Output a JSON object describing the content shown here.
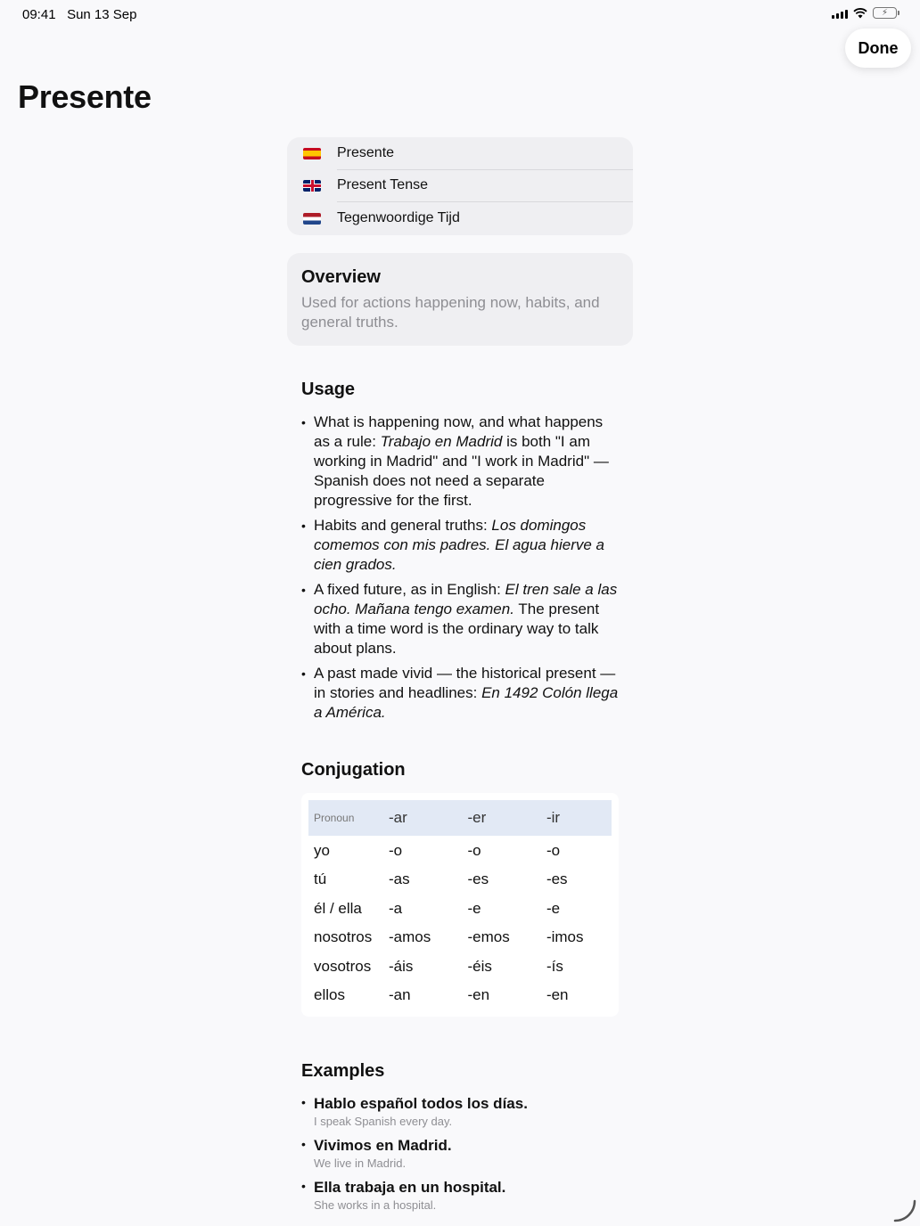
{
  "status_bar": {
    "time": "09:41",
    "date": "Sun 13 Sep"
  },
  "toolbar": {
    "done_label": "Done"
  },
  "title": "Presente",
  "names": [
    {
      "flag": "spain-flag-icon",
      "label": "Presente"
    },
    {
      "flag": "uk-flag-icon",
      "label": "Present Tense"
    },
    {
      "flag": "netherlands-flag-icon",
      "label": "Tegenwoordige Tijd"
    }
  ],
  "overview": {
    "title": "Overview",
    "text": "Used for actions happening now, habits, and general truths."
  },
  "usage": {
    "title": "Usage",
    "items": [
      [
        {
          "t": "What is happening now, and what happens as a rule: "
        },
        {
          "t": "Trabajo en Madrid",
          "i": true
        },
        {
          "t": " is both \"I am working in Madrid\" and \"I work in Madrid\" — Spanish does not need a separate progressive for the first."
        }
      ],
      [
        {
          "t": "Habits and general truths: "
        },
        {
          "t": "Los domingos comemos con mis padres. El agua hierve a cien grados.",
          "i": true
        }
      ],
      [
        {
          "t": "A fixed future, as in English: "
        },
        {
          "t": "El tren sale a las ocho. Mañana tengo examen.",
          "i": true
        },
        {
          "t": " The present with a time word is the ordinary way to talk about plans."
        }
      ],
      [
        {
          "t": "A past made vivid — the historical present — in stories and headlines: "
        },
        {
          "t": "En 1492 Colón llega a América.",
          "i": true
        }
      ]
    ]
  },
  "conjugation": {
    "title": "Conjugation",
    "headers": [
      "Pronoun",
      "-ar",
      "-er",
      "-ir"
    ],
    "rows": [
      [
        "yo",
        "-o",
        "-o",
        "-o"
      ],
      [
        "tú",
        "-as",
        "-es",
        "-es"
      ],
      [
        "él / ella",
        "-a",
        "-e",
        "-e"
      ],
      [
        "nosotros",
        "-amos",
        "-emos",
        "-imos"
      ],
      [
        "vosotros",
        "-áis",
        "-éis",
        "-ís"
      ],
      [
        "ellos",
        "-an",
        "-en",
        "-en"
      ]
    ]
  },
  "examples": {
    "title": "Examples",
    "items": [
      {
        "sentence": "Hablo español todos los días.",
        "translation": "I speak Spanish every day."
      },
      {
        "sentence": "Vivimos en Madrid.",
        "translation": "We live in Madrid."
      },
      {
        "sentence": "Ella trabaja en un hospital.",
        "translation": "She works in a hospital."
      }
    ]
  }
}
